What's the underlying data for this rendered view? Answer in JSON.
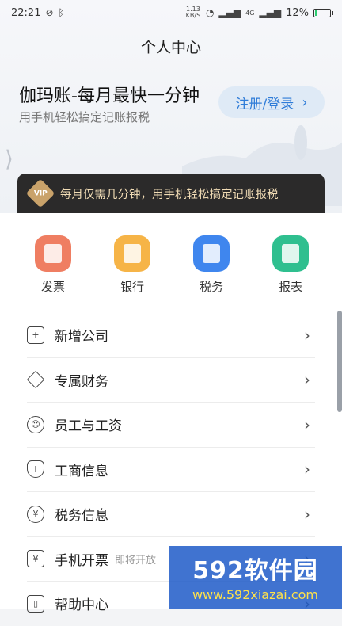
{
  "status_bar": {
    "time": "22:21",
    "speed": "1.13 KB/S",
    "network": "4G",
    "battery_percent": "12%",
    "battery_level": 0.12
  },
  "header": {
    "title": "个人中心",
    "hero_title": "伽玛账-每月最快一分钟",
    "hero_subtitle": "用手机轻松搞定记账报税",
    "login_label": "注册/登录"
  },
  "vip_banner": {
    "badge": "VIP",
    "text": "每月仅需几分钟，用手机轻松搞定记账报税"
  },
  "quick_actions": [
    {
      "label": "发票",
      "color": "#ef7e62"
    },
    {
      "label": "银行",
      "color": "#f6b447"
    },
    {
      "label": "税务",
      "color": "#3f86ee"
    },
    {
      "label": "报表",
      "color": "#2fbf8f"
    }
  ],
  "menu": [
    {
      "label": "新增公司",
      "icon": "add-company-icon"
    },
    {
      "label": "专属财务",
      "icon": "diamond-icon"
    },
    {
      "label": "员工与工资",
      "icon": "staff-icon"
    },
    {
      "label": "工商信息",
      "icon": "shield-icon"
    },
    {
      "label": "税务信息",
      "icon": "tax-icon"
    },
    {
      "label": "手机开票",
      "note": "即将开放",
      "icon": "invoice-icon"
    },
    {
      "label": "帮助中心",
      "icon": "book-icon"
    }
  ],
  "watermark": {
    "logo": "592软件园",
    "url": "www.592xiazai.com"
  }
}
